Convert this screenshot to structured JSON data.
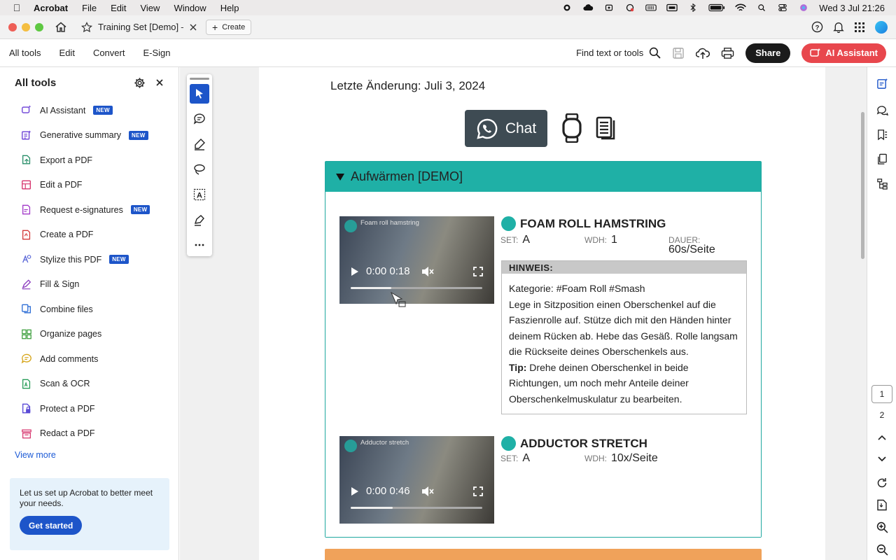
{
  "menubar": {
    "app": "Acrobat",
    "items": [
      "File",
      "Edit",
      "View",
      "Window",
      "Help"
    ],
    "clock": "Wed 3 Jul  21:26"
  },
  "tabbar": {
    "doc_tab": "Training Set [Demo] –...",
    "create": "Create"
  },
  "toolbar": {
    "tabs": [
      "All tools",
      "Edit",
      "Convert",
      "E-Sign"
    ],
    "find": "Find text or tools",
    "share": "Share",
    "ai": "AI Assistant"
  },
  "sidebar": {
    "title": "All tools",
    "badge": "NEW",
    "items": [
      {
        "label": "AI Assistant",
        "new": true,
        "icon": "ai-assistant-icon",
        "color": "#6a3fd6"
      },
      {
        "label": "Generative summary",
        "new": true,
        "icon": "generative-summary-icon",
        "color": "#6a3fd6"
      },
      {
        "label": "Export a PDF",
        "new": false,
        "icon": "export-pdf-icon",
        "color": "#2a8f6a"
      },
      {
        "label": "Edit a PDF",
        "new": false,
        "icon": "edit-pdf-icon",
        "color": "#d6336c"
      },
      {
        "label": "Request e-signatures",
        "new": true,
        "icon": "request-esign-icon",
        "color": "#a33bc9"
      },
      {
        "label": "Create a PDF",
        "new": false,
        "icon": "create-pdf-icon",
        "color": "#d43b3b"
      },
      {
        "label": "Stylize this PDF",
        "new": true,
        "icon": "stylize-icon",
        "color": "#5a67d8"
      },
      {
        "label": "Fill & Sign",
        "new": false,
        "icon": "fill-sign-icon",
        "color": "#8c3bbf"
      },
      {
        "label": "Combine files",
        "new": false,
        "icon": "combine-files-icon",
        "color": "#2f6fd6"
      },
      {
        "label": "Organize pages",
        "new": false,
        "icon": "organize-pages-icon",
        "color": "#3a9d3a"
      },
      {
        "label": "Add comments",
        "new": false,
        "icon": "add-comments-icon",
        "color": "#d6a51a"
      },
      {
        "label": "Scan & OCR",
        "new": false,
        "icon": "scan-ocr-icon",
        "color": "#2a9d5a"
      },
      {
        "label": "Protect a PDF",
        "new": false,
        "icon": "protect-pdf-icon",
        "color": "#5a4ad6"
      },
      {
        "label": "Redact a PDF",
        "new": false,
        "icon": "redact-pdf-icon",
        "color": "#d6336c"
      }
    ],
    "view_more": "View more",
    "setup_text": "Let us set up Acrobat to better meet your needs.",
    "get_started": "Get started"
  },
  "document": {
    "last_change": "Letzte Änderung:  Juli 3, 2024",
    "chat": "Chat",
    "section_title": "Aufwärmen [DEMO]",
    "exercises": [
      {
        "title": "FOAM ROLL HAMSTRING",
        "set_label": "SET:",
        "set": "A",
        "reps_label": "WDH:",
        "reps": "1",
        "duration_label": "DAUER:",
        "duration": "60s/Seite",
        "video_label": "Foam roll hamstring",
        "video_time": "0:00  0:18",
        "video_progress": 0.31
      },
      {
        "title": "ADDUCTOR STRETCH",
        "set_label": "SET:",
        "set": "A",
        "reps_label": "WDH:",
        "reps": "10x/Seite",
        "video_label": "Adductor stretch",
        "video_time": "0:00  0:46",
        "video_progress": 0.32
      }
    ],
    "hint_head": "HINWEIS:",
    "hint_category": "Kategorie: #Foam Roll #Smash",
    "hint_text": "Lege in Sitzposition einen Oberschenkel auf die Faszienrolle auf. Stütze dich mit den Händen hinter deinem Rücken ab. Hebe das Gesäß. Rolle langsam die Rückseite deines Oberschenkels aus.",
    "tip_label": "Tip:",
    "tip_text": " Drehe deinen Oberschenkel in beide Richtungen, um noch mehr Anteile deiner Oberschenkelmuskulatur zu bearbeiten."
  },
  "rail": {
    "page_current": "1",
    "page_next": "2"
  }
}
